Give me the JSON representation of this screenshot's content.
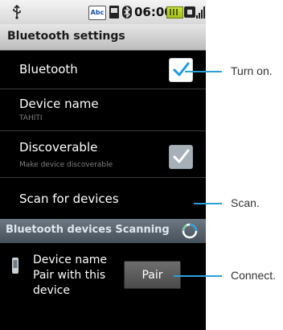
{
  "status_bar": {
    "time": "06:00",
    "keyboard_badge": "Abc",
    "icons": [
      "usb-icon",
      "keyboard-icon",
      "sd-card-icon",
      "bluetooth-icon",
      "battery-icon",
      "sim-icon",
      "signal-icon"
    ]
  },
  "title": "Bluetooth settings",
  "settings": {
    "bluetooth": {
      "label": "Bluetooth",
      "checked": true
    },
    "device_name": {
      "label": "Device name",
      "value": "TAHITI"
    },
    "discoverable": {
      "label": "Discoverable",
      "summary": "Make device discoverable",
      "checked": true
    },
    "scan": {
      "label": "Scan for devices"
    }
  },
  "section": {
    "title": "Bluetooth devices Scanning"
  },
  "device": {
    "line1": "Device name",
    "line2": "Pair with this",
    "line3": "device",
    "pair_label": "Pair"
  },
  "callouts": {
    "turn_on": "Turn on.",
    "scan": "Scan.",
    "connect": "Connect."
  },
  "colors": {
    "accent": "#2aa0d8",
    "check_blue": "#1e9ae0",
    "section_bg": "#56616b"
  }
}
